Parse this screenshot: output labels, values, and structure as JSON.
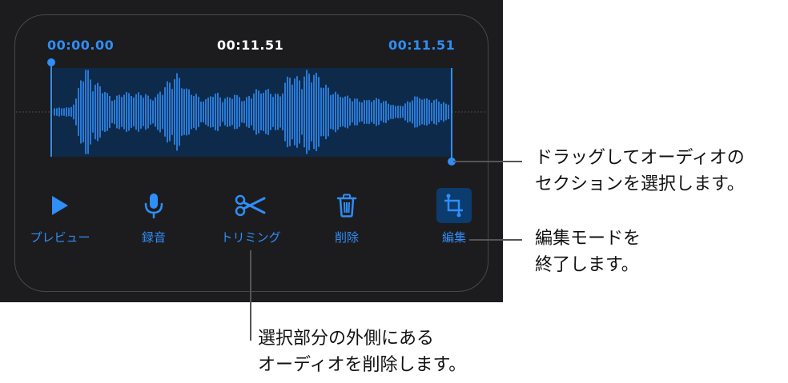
{
  "timeline": {
    "start_time": "00:00.00",
    "current_time": "00:11.51",
    "end_time": "00:11.51"
  },
  "toolbar": {
    "preview_label": "プレビュー",
    "record_label": "録音",
    "trim_label": "トリミング",
    "delete_label": "削除",
    "edit_label": "編集"
  },
  "callouts": {
    "drag": {
      "line1": "ドラッグしてオーディオの",
      "line2": "セクションを選択します。"
    },
    "edit": {
      "line1": "編集モードを",
      "line2": "終了します。"
    },
    "trim": {
      "line1": "選択部分の外側にある",
      "line2": "オーディオを削除します。"
    }
  },
  "colors": {
    "accent": "#2f8ef8",
    "panel": "#1c1c1e",
    "selection": "#0e2a4b"
  }
}
